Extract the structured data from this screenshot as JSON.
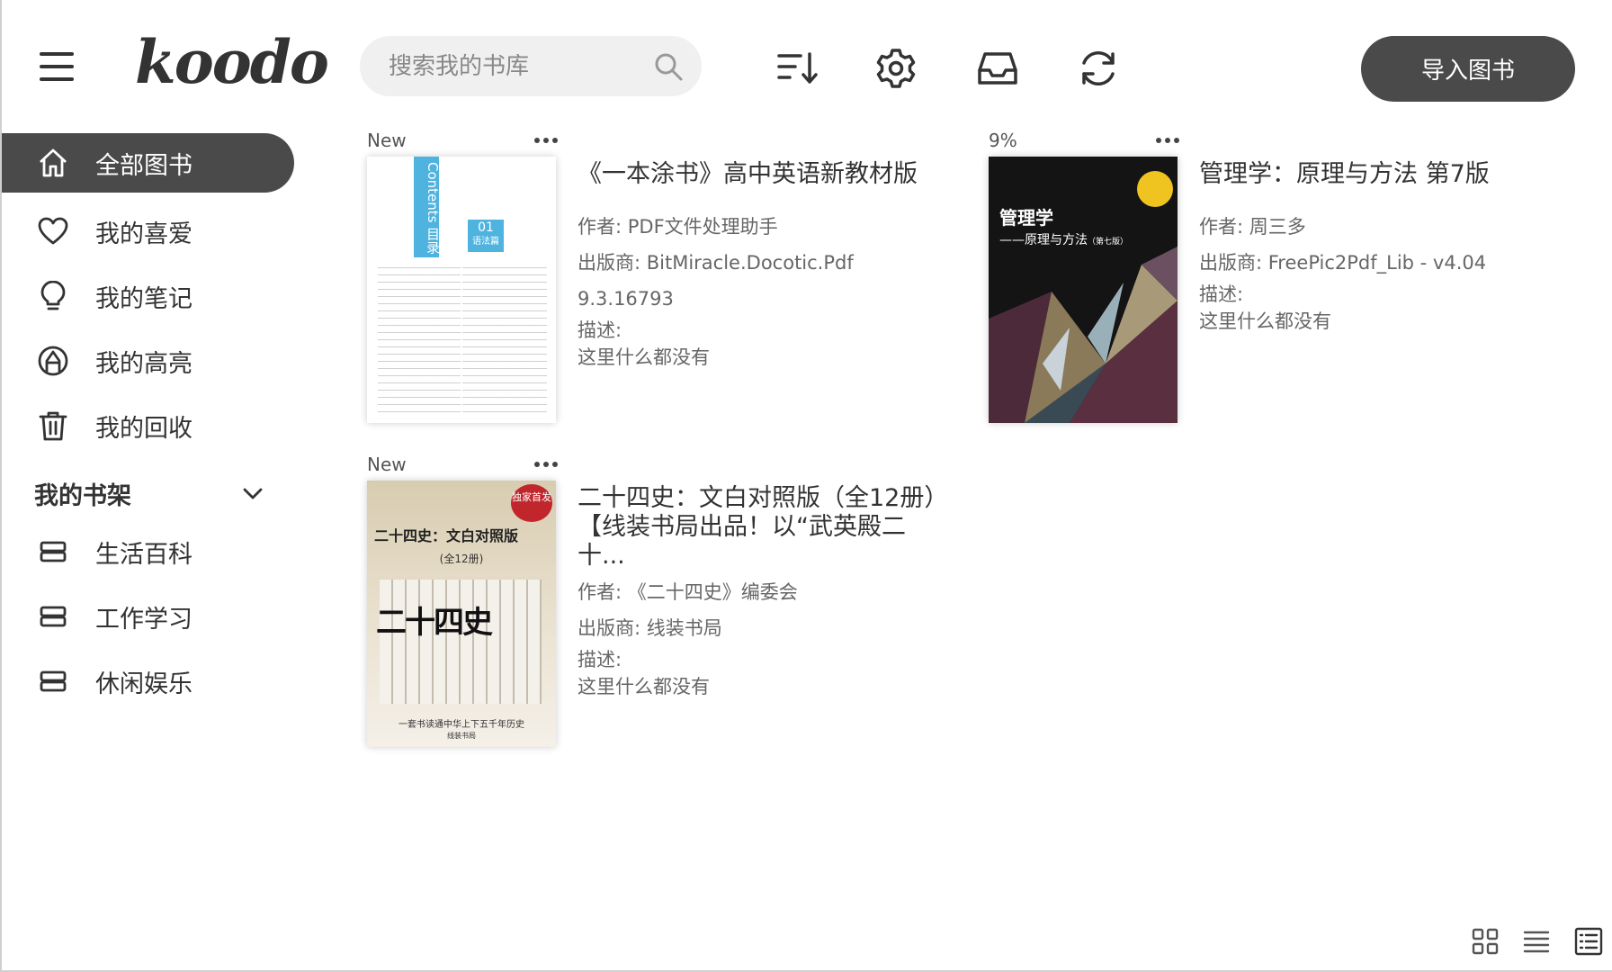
{
  "app": {
    "logo": "koodo"
  },
  "search": {
    "placeholder": "搜索我的书库"
  },
  "toolbar": {
    "icons": [
      "sort-icon",
      "gear-icon",
      "inbox-icon",
      "sync-icon"
    ],
    "import_label": "导入图书"
  },
  "sidebar": {
    "items": [
      {
        "label": "全部图书",
        "icon": "home-icon",
        "active": true
      },
      {
        "label": "我的喜爱",
        "icon": "heart-icon"
      },
      {
        "label": "我的笔记",
        "icon": "lightbulb-icon"
      },
      {
        "label": "我的高亮",
        "icon": "highlighter-icon"
      },
      {
        "label": "我的回收",
        "icon": "trash-icon"
      }
    ],
    "shelf_title": "我的书架",
    "shelves": [
      {
        "label": "生活百科",
        "icon": "shelf-icon"
      },
      {
        "label": "工作学习",
        "icon": "shelf-icon"
      },
      {
        "label": "休闲娱乐",
        "icon": "shelf-icon"
      }
    ]
  },
  "books": [
    {
      "badge": "New",
      "title": "《一本涂书》高中英语新教材版",
      "author": "作者: PDF文件处理助手",
      "publisher": "出版商: BitMiracle.Docotic.Pdf 9.3.16793",
      "desc_label": "描述:",
      "desc": "这里什么都没有",
      "cover": {
        "vertical_text": "Contents 目录",
        "badge_num": "01",
        "badge_sub": "语法篇"
      }
    },
    {
      "badge": "9%",
      "title": "管理学：原理与方法 第7版",
      "author": "作者: 周三多",
      "publisher": "出版商: FreePic2Pdf_Lib - v4.04",
      "desc_label": "描述:",
      "desc": "这里什么都没有",
      "cover": {
        "title": "管理学",
        "subtitle": "——原理与方法",
        "edition": "（第七版）"
      }
    },
    {
      "badge": "New",
      "title": "二十四史：文白对照版（全12册）【线装书局出品！以“武英殿二十...",
      "author": "作者: 《二十四史》编委会",
      "publisher": "出版商: 线装书局",
      "desc_label": "描述:",
      "desc": "这里什么都没有",
      "cover": {
        "title": "二十四史：文白对照版",
        "subtitle": "(全12册)",
        "tag": "独家首发",
        "calligraphy": "二十四史",
        "footer": "一套书读通中华上下五千年历史",
        "publisher_mark": "线装书局"
      }
    }
  ],
  "colors": {
    "accent": "#4a4a4a",
    "bg": "#ffffff",
    "search_bg": "#f0f0f0"
  }
}
